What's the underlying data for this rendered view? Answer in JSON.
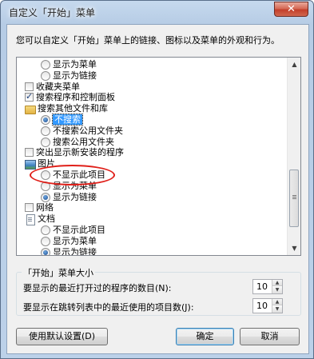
{
  "window": {
    "title": "自定义「开始」菜单",
    "close_glyph": "✕"
  },
  "description": "您可以自定义「开始」菜单上的链接、图标以及菜单的外观和行为。",
  "list_items": [
    {
      "type": "radio",
      "checked": false,
      "label": "显示为菜单"
    },
    {
      "type": "radio",
      "checked": false,
      "label": "显示为链接"
    },
    {
      "type": "checkbox",
      "checked": false,
      "label": "收藏夹菜单"
    },
    {
      "type": "checkbox",
      "checked": true,
      "label": "搜索程序和控制面板"
    },
    {
      "type": "folder",
      "icon": "folder-icon",
      "label": "搜索其他文件和库"
    },
    {
      "type": "radio",
      "checked": true,
      "label": "不搜索",
      "selected": true
    },
    {
      "type": "radio",
      "checked": false,
      "label": "不搜索公用文件夹"
    },
    {
      "type": "radio",
      "checked": false,
      "label": "搜索公用文件夹"
    },
    {
      "type": "checkbox",
      "checked": false,
      "label": "突出显示新安装的程序"
    },
    {
      "type": "folder",
      "icon": "pictures-icon",
      "label": "图片"
    },
    {
      "type": "radio",
      "checked": false,
      "label": "不显示此项目"
    },
    {
      "type": "radio",
      "checked": false,
      "label": "显示为菜单"
    },
    {
      "type": "radio",
      "checked": true,
      "label": "显示为链接"
    },
    {
      "type": "checkbox",
      "checked": false,
      "label": "网络"
    },
    {
      "type": "folder",
      "icon": "documents-icon",
      "label": "文档"
    },
    {
      "type": "radio",
      "checked": false,
      "label": "不显示此项目"
    },
    {
      "type": "radio",
      "checked": false,
      "label": "显示为菜单"
    },
    {
      "type": "radio",
      "checked": true,
      "label": "显示为链接"
    }
  ],
  "scrollbar": {
    "up_glyph": "▲",
    "down_glyph": "▼"
  },
  "size_group": {
    "legend": "「开始」菜单大小",
    "recent_programs_label": "要显示的最近打开过的程序的数目(N):",
    "recent_programs_value": "10",
    "jump_list_label": "要显示在跳转列表中的最近使用的项目数(J):",
    "jump_list_value": "10",
    "spin_up_glyph": "▲",
    "spin_down_glyph": "▼"
  },
  "buttons": {
    "defaults": "使用默认设置(D)",
    "ok": "确定",
    "cancel": "取消"
  },
  "colors": {
    "selection": "#3399ff",
    "annotation_ellipse": "#e0201a"
  }
}
